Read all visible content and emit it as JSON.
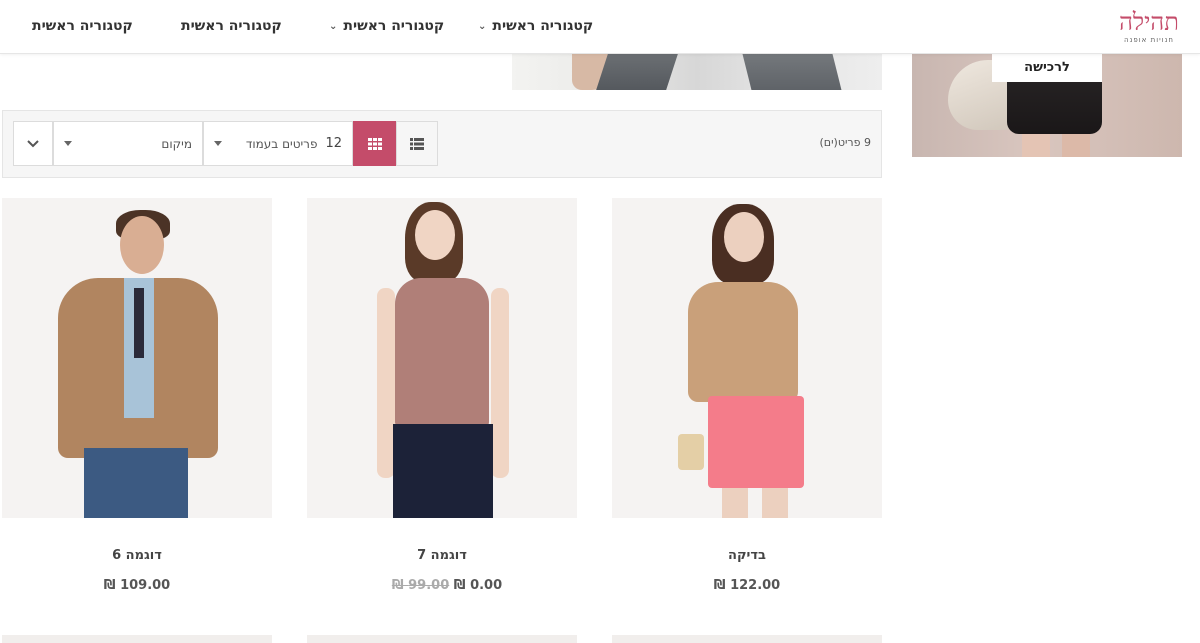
{
  "header": {
    "logo": {
      "main": "תהילה",
      "sub": "חנויות אופנה"
    },
    "nav": [
      {
        "label": "קטגוריה ראשית",
        "has_dropdown": true
      },
      {
        "label": "קטגוריה ראשית",
        "has_dropdown": true
      },
      {
        "label": "קטגוריה ראשית",
        "has_dropdown": false
      },
      {
        "label": "קטגוריה ראשית",
        "has_dropdown": false
      }
    ]
  },
  "sidebar": {
    "banner_button": "לרכישה"
  },
  "toolbar": {
    "item_count": "9 פריט(ים)",
    "per_page_value": "12",
    "per_page_label": "פריטים בעמוד",
    "sort_value": "מיקום",
    "view_mode": "grid"
  },
  "products": [
    {
      "name": "בדיקה",
      "price": "122.00 ₪",
      "old_price": ""
    },
    {
      "name": "דוגמה 7",
      "price": "0.00 ₪",
      "old_price": "99.00 ₪"
    },
    {
      "name": "דוגמה 6",
      "price": "109.00 ₪",
      "old_price": ""
    }
  ],
  "colors": {
    "accent": "#c44c6a",
    "toolbar_bg": "#f6f6f6",
    "border": "#dcdcdc"
  },
  "icons": [
    "chevron-down-icon",
    "list-view-icon",
    "grid-view-icon",
    "sort-direction-icon"
  ]
}
